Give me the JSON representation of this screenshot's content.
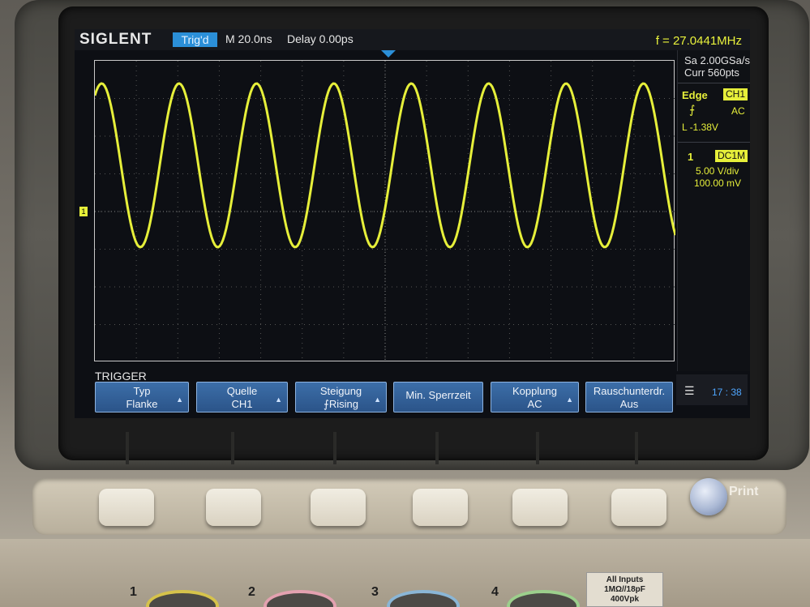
{
  "header": {
    "brand": "SIGLENT",
    "trigger_status": "Trig'd",
    "timebase": "M 20.0ns",
    "delay": "Delay 0.00ps",
    "frequency": "f = 27.0441MHz"
  },
  "acquisition": {
    "sample_rate": "Sa 2.00GSa/s",
    "current_points": "Curr 560pts"
  },
  "trigger_panel": {
    "type": "Edge",
    "source": "CH1",
    "slope_icon": "rising-edge-icon",
    "coupling": "AC",
    "level": "L  -1.38V"
  },
  "channel_panel": {
    "channel": "1",
    "coupling": "DC1M",
    "volts_per_div": "5.00 V/div",
    "offset": "100.00 mV"
  },
  "ground_marker": "1",
  "menu": {
    "title": "TRIGGER",
    "softkeys": [
      {
        "line1": "Typ",
        "line2": "Flanke"
      },
      {
        "line1": "Quelle",
        "line2": "CH1"
      },
      {
        "line1": "Steigung",
        "line2": "⨍Rising"
      },
      {
        "line1": "Min. Sperrzeit",
        "line2": ""
      },
      {
        "line1": "Kopplung",
        "line2": "AC"
      },
      {
        "line1": "Rauschunterdr.",
        "line2": "Aus"
      }
    ]
  },
  "status": {
    "network_icon": "network-disconnected-icon",
    "time": "17 : 38"
  },
  "panel": {
    "print_label": "Print",
    "inputs_label": "All Inputs",
    "inputs_spec1": "1MΩ//18pF",
    "inputs_spec2": "400Vpk",
    "ports": [
      "1",
      "2",
      "3",
      "4"
    ]
  },
  "waveform": {
    "color": "#e6ef3a",
    "cycles_visible": 7.5
  }
}
